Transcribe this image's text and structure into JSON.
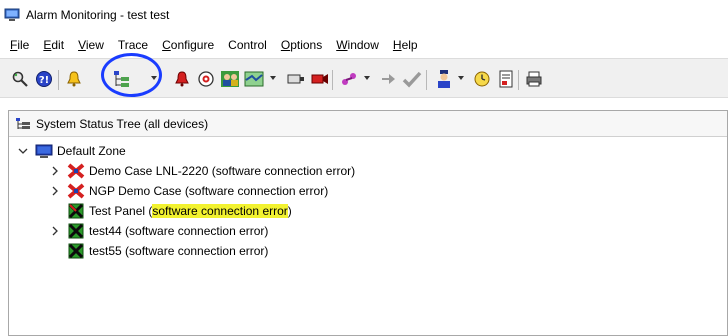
{
  "window": {
    "title": "Alarm Monitoring - test test",
    "icon": "monitor-app-icon"
  },
  "menu": {
    "items": [
      {
        "label": "File",
        "underline": "F",
        "rest": "ile"
      },
      {
        "label": "Edit",
        "underline": "E",
        "rest": "dit"
      },
      {
        "label": "View",
        "underline": "V",
        "rest": "iew"
      },
      {
        "label": "Trace",
        "underline": "",
        "rest": "Trace"
      },
      {
        "label": "Configure",
        "underline": "C",
        "rest": "onfigure"
      },
      {
        "label": "Control",
        "underline": "",
        "rest": "Control"
      },
      {
        "label": "Options",
        "underline": "O",
        "rest": "ptions"
      },
      {
        "label": "Window",
        "underline": "W",
        "rest": "indow"
      },
      {
        "label": "Help",
        "underline": "H",
        "rest": "elp"
      }
    ]
  },
  "toolbar": {
    "buttons": [
      "find-icon",
      "badge-icon",
      "alarm-bell-icon",
      "system-tree-icon",
      "alarm-red-icon",
      "globe-icon",
      "people-icon",
      "map-icon",
      "reader-icon",
      "camera-icon",
      "link-icon",
      "output-icon",
      "checkmark-icon",
      "guard-icon",
      "clock-icon",
      "report-icon",
      "print-icon"
    ],
    "accent_annotation_color": "#1a3cff"
  },
  "panel": {
    "title": "System Status Tree (all devices)"
  },
  "tree": {
    "root": {
      "label": "Default Zone",
      "expanded": true
    },
    "nodes": [
      {
        "label": "Demo Case LNL-2220 (software connection error)",
        "icon": "panel-error-icon",
        "expandable": true
      },
      {
        "label": "NGP Demo Case (software connection error)",
        "icon": "panel-error-icon",
        "expandable": true
      },
      {
        "label_prefix": "Test Panel (",
        "label_highlight": "software connection error",
        "label_suffix": ")",
        "icon": "panel-disconnected-icon",
        "expandable": false
      },
      {
        "label": "test44 (software connection error)",
        "icon": "panel-disconnected-icon",
        "expandable": true
      },
      {
        "label": "test55 (software connection error)",
        "icon": "panel-disconnected-icon",
        "expandable": false
      }
    ],
    "highlight_color": "#f2f230"
  }
}
